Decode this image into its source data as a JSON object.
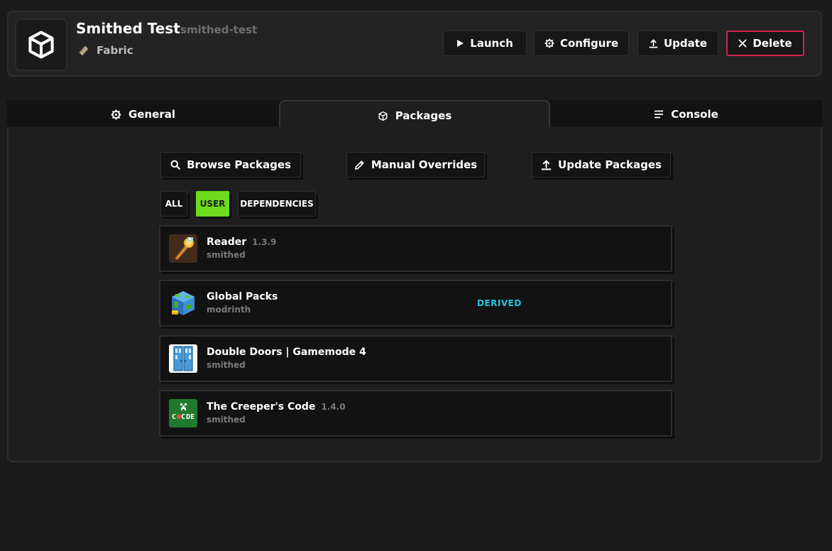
{
  "header": {
    "title": "Smithed Test",
    "slug": "smithed-test",
    "loader": "Fabric",
    "buttons": {
      "launch": "Launch",
      "configure": "Configure",
      "update": "Update",
      "delete": "Delete"
    }
  },
  "tabs": {
    "general": "General",
    "packages": "Packages",
    "console": "Console",
    "active": "packages"
  },
  "actions": {
    "browse": "Browse Packages",
    "manual": "Manual Overrides",
    "update": "Update Packages"
  },
  "filters": {
    "all": "ALL",
    "user": "USER",
    "dependencies": "DEPENDENCIES",
    "selected": "USER"
  },
  "packages": [
    {
      "name": "Reader",
      "version": "1.3.9",
      "source": "smithed",
      "badge": "",
      "icon": "torch-icon"
    },
    {
      "name": "Global Packs",
      "version": "",
      "source": "modrinth",
      "badge": "DERIVED",
      "icon": "globe-block-icon"
    },
    {
      "name": "Double Doors | Gamemode 4",
      "version": "",
      "source": "smithed",
      "badge": "",
      "icon": "double-door-icon"
    },
    {
      "name": "The Creeper's Code",
      "version": "1.4.0",
      "source": "smithed",
      "badge": "",
      "icon": "creeper-code-icon"
    }
  ],
  "colors": {
    "accent_green": "#6ddc1c",
    "delete_red": "#d4224f",
    "derived_cyan": "#29c4d8",
    "background": "#1b1b1b"
  }
}
